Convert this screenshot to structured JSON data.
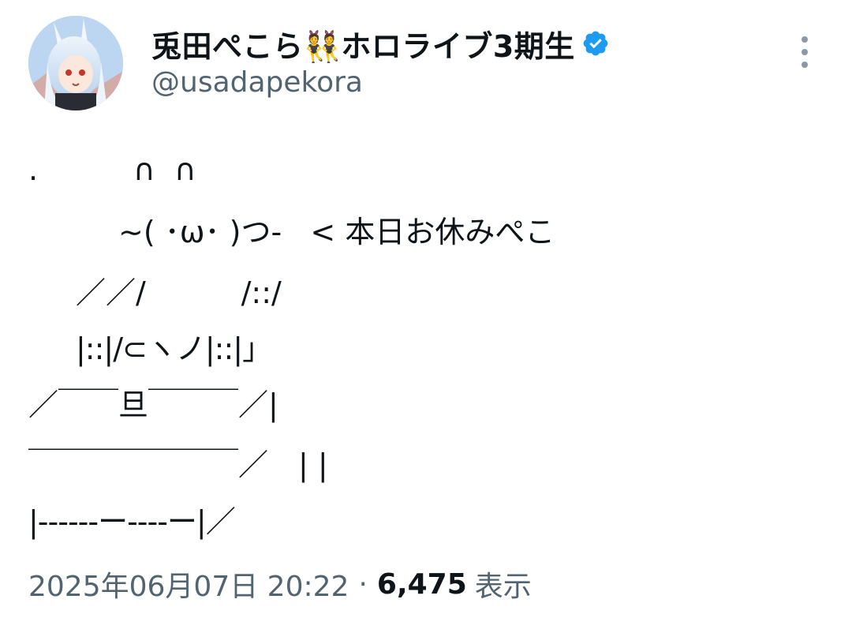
{
  "author": {
    "name": "兎田ぺこら👯ホロライブ3期生",
    "handle": "@usadapekora",
    "verified": true
  },
  "post": {
    "lines": [
      ".          ∩  ∩",
      "∼( ･ω･ )つ-   < 本日お休みぺこ",
      "／／/          /::/",
      "|::|/⊂ヽノ|::|」",
      "／￣￣旦￣￣￣／|",
      "￣￣￣￣￣￣￣／　| |",
      "|------ー----ー|／"
    ]
  },
  "meta": {
    "date": "2025年06月07日 20:22",
    "separator": "·",
    "views_count": "6,475",
    "views_label": "表示"
  },
  "colors": {
    "verified_blue": "#1d9bf0",
    "secondary_text": "#536471",
    "primary_text": "#0f1419"
  },
  "icons": {
    "verified": "verified-badge-icon",
    "more": "more-vertical-icon"
  }
}
